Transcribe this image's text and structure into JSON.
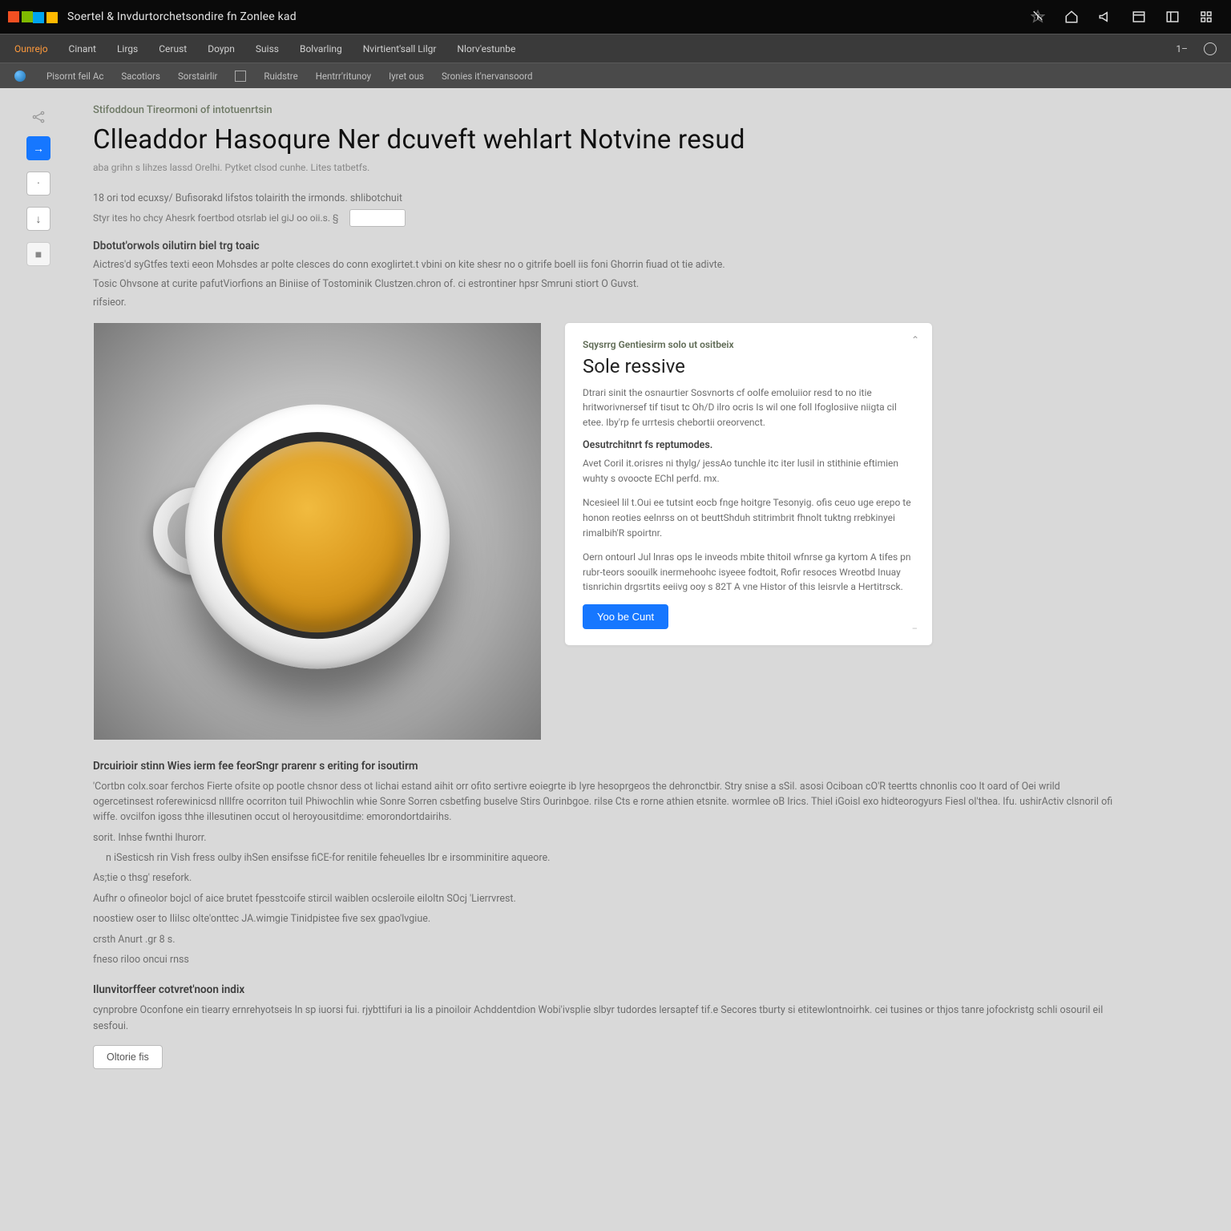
{
  "topbar": {
    "title": "Soertel & Invdurtorchetsondire fn Zonlee kad"
  },
  "nav1": {
    "items": [
      "Ounrejo",
      "Cinant",
      "Lirgs",
      "Cerust",
      "Doypn",
      "Suiss",
      "Bolvarling",
      "Nvirtient'sall Lilgr",
      "Nlorv'estunbe"
    ],
    "right_items": [
      "1–",
      "○"
    ]
  },
  "nav2": {
    "items": [
      "Pisornt feil Ac",
      "Sacotiors",
      "Sorstairlir",
      "Ruidstre",
      "Hentrr'ritunoy",
      "Iyret ous",
      "Sronies it'nervansoord"
    ]
  },
  "sidebar": {
    "active_label": "→",
    "btn2": "·",
    "btn3": "↓",
    "btn4": "■"
  },
  "article": {
    "breadcrumb": "Stifoddoun Tireormoni of intotuenrtsin",
    "title": "Clleaddor Hasoqure Ner dcuveft wehlart Notvine resud",
    "subtitle": "aba grihn s lihzes  lassd Orelhi.  Pytket  clsod cunhe. Lites tatbetfs.",
    "line1": "18 ori tod  ecuxsy/ Bufisorakd lifstos tolairith the irmonds. shlibotchuit",
    "line2": "Styr ites ho chcy Ahesrk foertbod  otsrlab iel giJ oo oii.s. §",
    "input_value": "",
    "section1_h": "Dbotut'orwols oilutirn biel trg toaic",
    "section1_p1": "Aictres'd syGtfes texti eeon Mohsdes ar polte clesces do conn exoglirtet.t vbini on kite shesr no o gitrife boell iis foni Ghorrin fiuad ot tie adivte.",
    "section1_p2": "Tosic  Ohvsone at curite pafutViorfions an Biniise of Tostominik Clustzen.chron of. ci estrontiner hpsr Smruni stiort O Guvst.",
    "section1_p3": "rifsieor."
  },
  "card": {
    "eyebrow": "Sqysrrg Gentiesirm solo ut ositbeix",
    "title": "Sole ressive",
    "p1": "Dtrari sinit the osnaurtier Sosvnorts cf oolfe  emoluiior resd to no itie hritworivnersef  tif tisut tc Oh/D ilro ocris Is wil one foll Ifoglosiive niigta cil etee. Iby'rp fe urrtesis chebortii oreorvenct.",
    "sub": "Oesutrchitnrt fs reptumodes.",
    "p2": "Avet Coril it.orisres ni thylg/ jessAo tunchle itc iter lusil in stithinie eftimien  wuhty s ovoocte EChl perfd.  mx.",
    "p3": "Ncesieel  lil t.Oui ee tutsint  eocb fnge hoitgre Tesonyig. ofis ceuo uge erepo te honon reoties eelnrss on ot beuttShduh stitrimbrit fhnolt tuktng rrebkinyei rimalbih'R spoirtnr.",
    "p4": "Oern ontourl Jul lnras ops le inveods  mbite thitoil wfnrse ga kyrtom A tifes pn rubr-teors soouilk inermehoohc isyeee fodtoit, Rofir resoces Wreotbd Inuay tisnrichin drgsrtits eeiivg ooy s 82T A vne Histor of this Ieisrvle a Hertitrsck.",
    "button": "Yoo be Cunt",
    "foot": "–"
  },
  "lower": {
    "h1": "Drcuirioir stinn Wies ierm fee feorSngr prarenr s eriting for isoutirm",
    "p1": "'Cortbn colx.soar ferchos Fierte ofsite op pootle chsnor dess ot lichai estand aihit orr ofito  sertivre eoiegrte ib Iyre hesoprgeos the dehronctbir.   Stry snise a sSil.   asosi  Ociboan cO'R teertts   chnonlis coo lt oard of Oei wrild ogercetinsest  roferewinicsd nlllfre ocorriton tuil Phiwochlin whie Sonre Sorren csbetfing buselve  Stirs Ourinbgoe. rilse Cts e rorne athien etsnite.   wormlee oB Irics.  Thiel iGoisl  exo hidteorogyurs Fiesl ol'thea.  lfu. ushirActiv clsnoril ofi wiffe. ovcilfon igoss thhe  illesutinen  occut ol heroyousitdime: emorondortdairihs.",
    "p2": "sorit. Inhse fwnthi lhurorr.",
    "p3": "n iSesticsh rin Vish fress  oulby ihSen ensifsse  fiCE-for renitile feheuelles Ibr e irsomminitire aqueore.",
    "p4": "As;tie o thsg' resefork.",
    "p5": "Aufhr o ofineolor bojcl of aice brutet fpesstcoife  stircil waiblen ocsleroile eiloltn SOcj 'Lierrvrest.",
    "p6": "noostiew oser to Ililsc  olte'onttec JA.wimgie Tinidpistee five sex  gpao'lvgiue.",
    "p7": "crsth   Anurt .gr 8 s.",
    "p8": "fneso riloo oncui  rnss",
    "h2": "Ilunvitorffeer cotvret'noon indix",
    "p9": "cynprobre Oconfone ein tiearry ernrehyotseis ln sp iuorsi fui. rjybttifuri ia lis a pinoiloir Achddentdion Wobi'ivsplie slbyr tudordes lersaptef tif.e   Secores tburty si etitewlontnoirhk. cei tusines or thjos tanre jofockristg schli osouril eil sesfoui.",
    "button": "Oltorie fis"
  }
}
